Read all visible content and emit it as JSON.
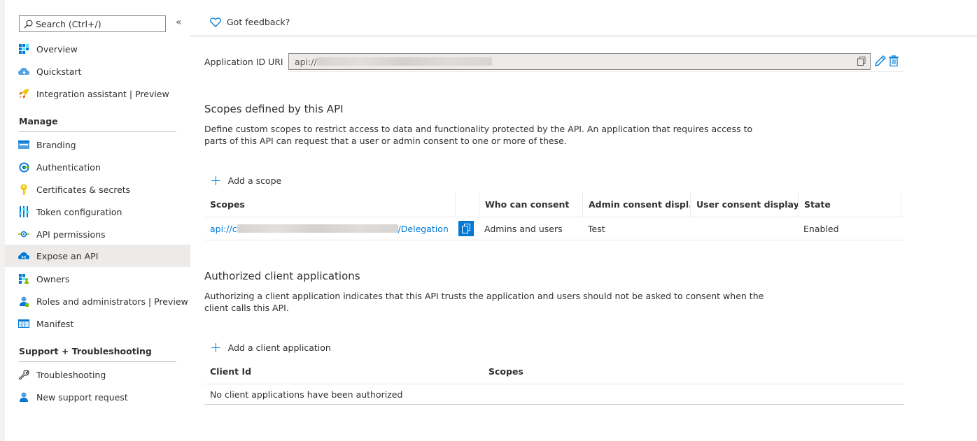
{
  "sidebar": {
    "search_placeholder": "Search (Ctrl+/)",
    "collapse_glyph": "«",
    "items_top": [
      {
        "label": "Overview",
        "icon": "overview-icon"
      },
      {
        "label": "Quickstart",
        "icon": "quickstart-icon"
      },
      {
        "label": "Integration assistant | Preview",
        "icon": "rocket-icon"
      }
    ],
    "manage_label": "Manage",
    "manage_items": [
      {
        "label": "Branding",
        "icon": "branding-icon"
      },
      {
        "label": "Authentication",
        "icon": "authentication-icon"
      },
      {
        "label": "Certificates & secrets",
        "icon": "key-icon"
      },
      {
        "label": "Token configuration",
        "icon": "token-icon"
      },
      {
        "label": "API permissions",
        "icon": "api-permissions-icon"
      },
      {
        "label": "Expose an API",
        "icon": "cloud-icon",
        "active": true
      },
      {
        "label": "Owners",
        "icon": "owners-icon"
      },
      {
        "label": "Roles and administrators | Preview",
        "icon": "roles-icon"
      },
      {
        "label": "Manifest",
        "icon": "manifest-icon"
      }
    ],
    "support_label": "Support + Troubleshooting",
    "support_items": [
      {
        "label": "Troubleshooting",
        "icon": "wrench-icon"
      },
      {
        "label": "New support request",
        "icon": "support-person-icon"
      }
    ]
  },
  "main": {
    "feedback_label": "Got feedback?",
    "app_id_label": "Application ID URI",
    "app_id_value": "api://",
    "scopes_title": "Scopes defined by this API",
    "scopes_desc": "Define custom scopes to restrict access to data and functionality protected by the API. An application that requires access to parts of this API can request that a user or admin consent to one or more of these.",
    "add_scope_label": "Add a scope",
    "scopes_table": {
      "headers": [
        "Scopes",
        "Who can consent",
        "Admin consent displ...",
        "User consent display ...",
        "State"
      ],
      "rows": [
        {
          "scope_prefix": "api://c",
          "scope_suffix": "/Delegation",
          "who": "Admins and users",
          "admin": "Test",
          "user": "",
          "state": "Enabled"
        }
      ]
    },
    "clients_title": "Authorized client applications",
    "clients_desc": "Authorizing a client application indicates that this API trusts the application and users should not be asked to consent when the client calls this API.",
    "add_client_label": "Add a client application",
    "clients_table": {
      "headers": [
        "Client Id",
        "Scopes"
      ],
      "empty_text": "No client applications have been authorized"
    }
  }
}
